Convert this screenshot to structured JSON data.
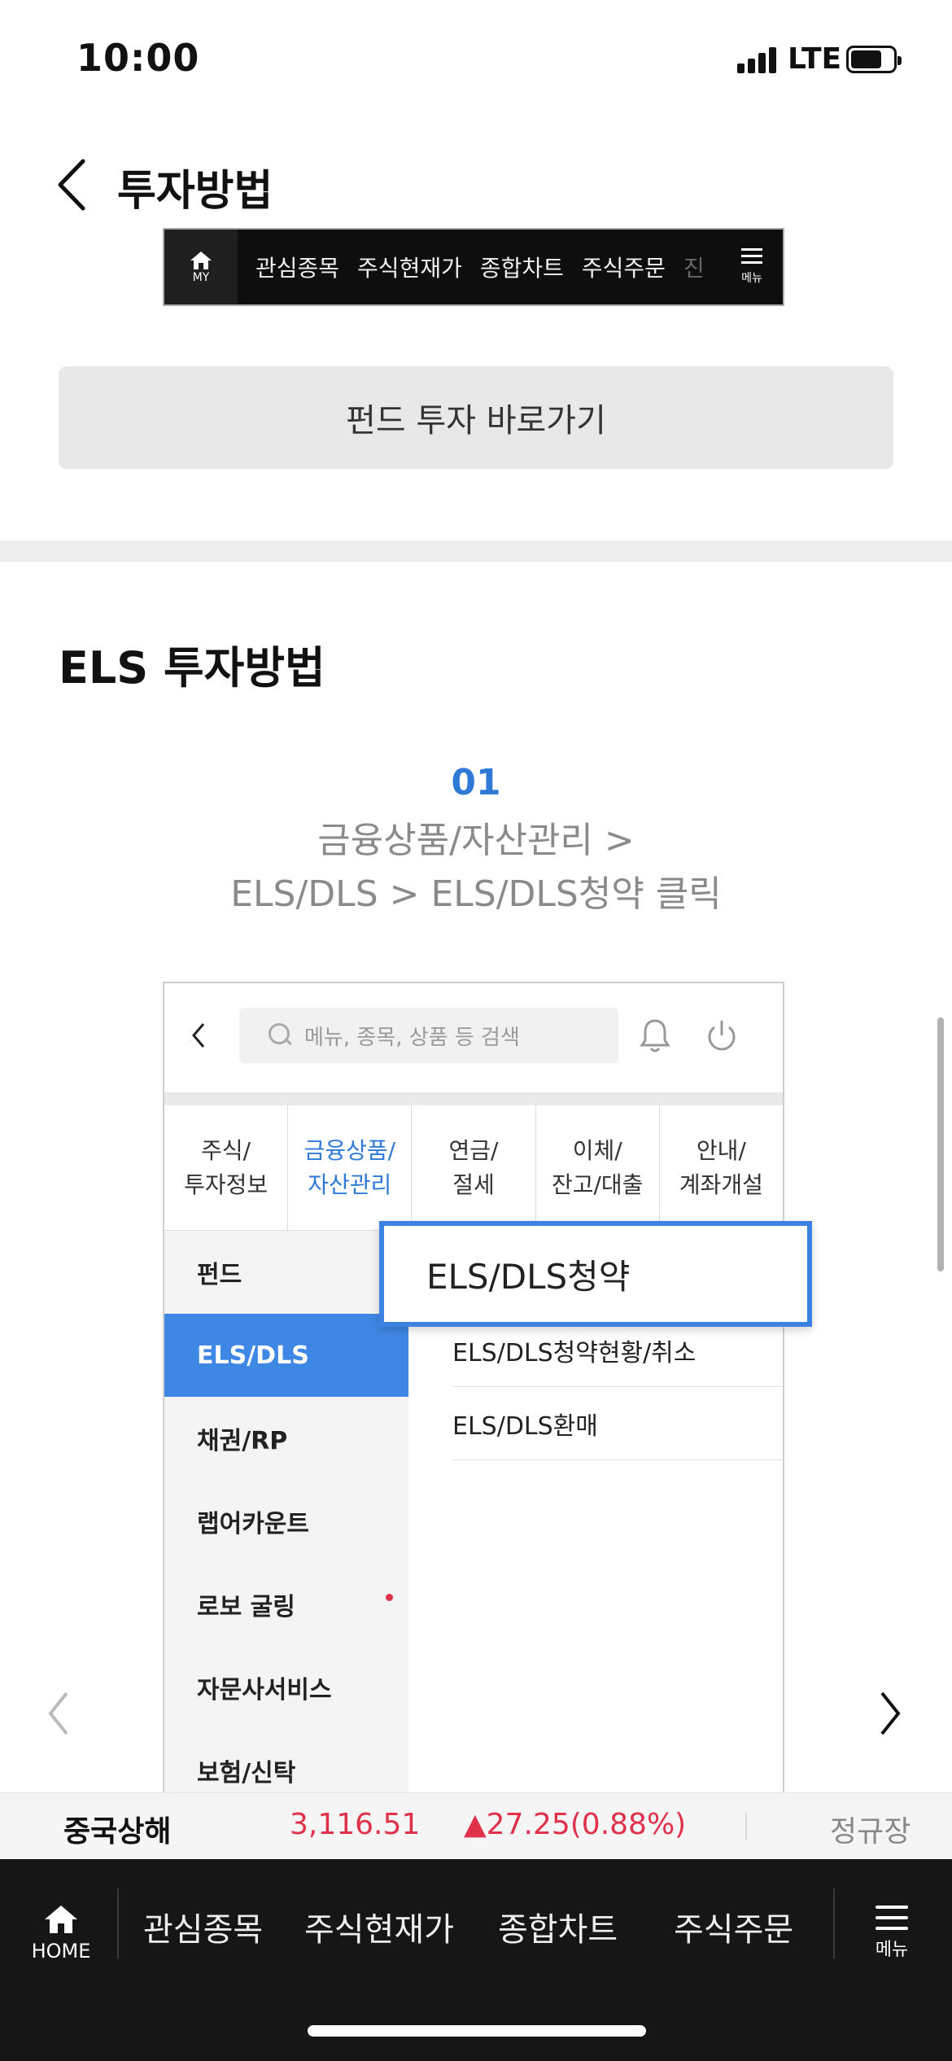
{
  "status_bar": {
    "time": "10:00",
    "network": "LTE"
  },
  "header": {
    "title": "투자방법"
  },
  "app_nav_preview": {
    "home_label": "MY",
    "items": [
      "관심종목",
      "주식현재가",
      "종합차트",
      "주식주문"
    ],
    "faded_item": "진",
    "menu_label": "메뉴"
  },
  "fund_button": {
    "label": "펀드 투자 바로가기"
  },
  "section": {
    "title": "ELS 투자방법"
  },
  "step": {
    "number": "01",
    "line1": "금융상품/자산관리 >",
    "line2": "ELS/DLS > ELS/DLS청약 클릭"
  },
  "screenshot": {
    "search_placeholder": "메뉴, 종목, 상품 등 검색",
    "tabs": [
      {
        "label": "주식/\n투자정보",
        "active": false
      },
      {
        "label": "금융상품/\n자산관리",
        "active": true
      },
      {
        "label": "연금/\n절세",
        "active": false
      },
      {
        "label": "이체/\n잔고/대출",
        "active": false
      },
      {
        "label": "안내/\n계좌개설",
        "active": false
      }
    ],
    "side_items": [
      "펀드",
      "ELS/DLS",
      "채권/RP",
      "랩어카운트",
      "로보 굴링",
      "자문사서비스",
      "보험/신탁"
    ],
    "active_side_item": "ELS/DLS",
    "sub_items": [
      "ELS/DLS청약현황/취소",
      "ELS/DLS환매"
    ],
    "highlight": "ELS/DLS청약"
  },
  "ticker": {
    "name": "중국상해",
    "value": "3,116.51",
    "change": "▲27.25(0.88%)",
    "session": "정규장",
    "up_color": "#e0314b"
  },
  "bottom_nav": {
    "home_label": "HOME",
    "items": [
      "관심종목",
      "주식현재가",
      "종합차트",
      "주식주문"
    ],
    "menu_label": "메뉴"
  },
  "colors": {
    "accent": "#2f7ad6",
    "highlight_border": "#3c82e2",
    "active_side": "#3f87e4"
  }
}
